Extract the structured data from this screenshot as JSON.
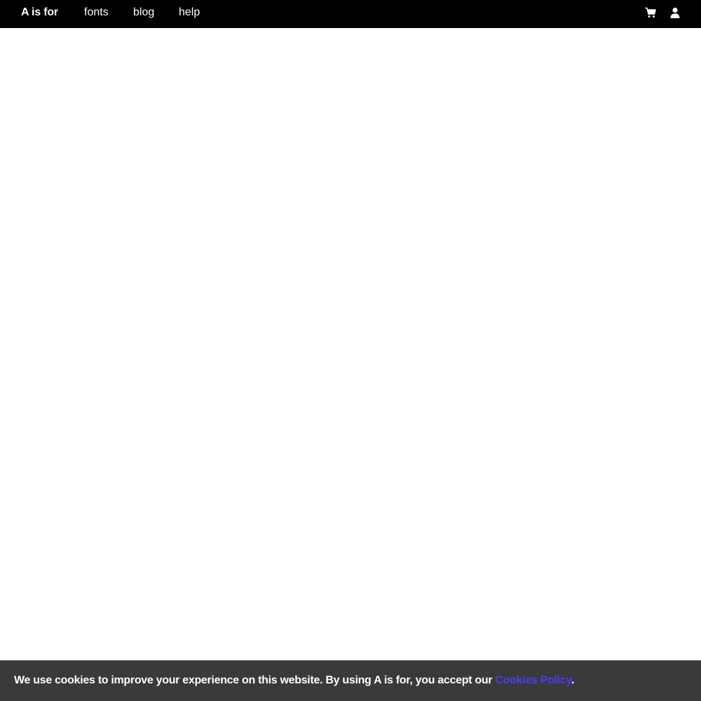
{
  "header": {
    "brand": "A is for",
    "nav": {
      "fonts": "fonts",
      "blog": "blog",
      "help": "help"
    },
    "icons": {
      "cart": "cart-icon",
      "account": "user-icon"
    }
  },
  "cookie_banner": {
    "text": "We use cookies to improve your experience on this website. By using A is for, you accept our ",
    "link_label": "Cookies Policy",
    "trailing": ".",
    "link_color": "#4a3cf0",
    "background": "#3a3a3a"
  }
}
